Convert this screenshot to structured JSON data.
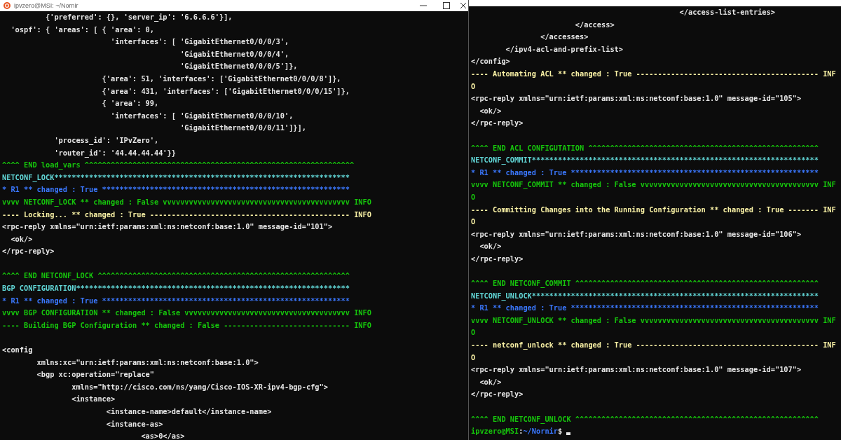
{
  "windows": [
    {
      "title": "ipvzero@MSI: ~/Nornir",
      "lines": [
        {
          "kind": "text",
          "color": "#e6e6e6",
          "text": "          {'preferred': {}, 'server_ip': '6.6.6.6'}],"
        },
        {
          "kind": "text",
          "color": "#e6e6e6",
          "text": "  'ospf': { 'areas': [ { 'area': 0,"
        },
        {
          "kind": "text",
          "color": "#e6e6e6",
          "text": "                         'interfaces': [ 'GigabitEthernet0/0/0/3',"
        },
        {
          "kind": "text",
          "color": "#e6e6e6",
          "text": "                                         'GigabitEthernet0/0/0/4',"
        },
        {
          "kind": "text",
          "color": "#e6e6e6",
          "text": "                                         'GigabitEthernet0/0/0/5']},"
        },
        {
          "kind": "text",
          "color": "#e6e6e6",
          "text": "                       {'area': 51, 'interfaces': ['GigabitEthernet0/0/0/8']},"
        },
        {
          "kind": "text",
          "color": "#e6e6e6",
          "text": "                       {'area': 431, 'interfaces': ['GigabitEthernet0/0/0/15']},"
        },
        {
          "kind": "text",
          "color": "#e6e6e6",
          "text": "                       { 'area': 99,"
        },
        {
          "kind": "text",
          "color": "#e6e6e6",
          "text": "                         'interfaces': [ 'GigabitEthernet0/0/0/10',"
        },
        {
          "kind": "text",
          "color": "#e6e6e6",
          "text": "                                         'GigabitEthernet0/0/0/11']}],"
        },
        {
          "kind": "text",
          "color": "#e6e6e6",
          "text": "            'process_id': 'IPvZero',"
        },
        {
          "kind": "text",
          "color": "#e6e6e6",
          "text": "            'router_id': '44.44.44.44'}}"
        },
        {
          "kind": "text",
          "color": "#16c60c",
          "text": "^^^^ END load_vars ^^^^^^^^^^^^^^^^^^^^^^^^^^^^^^^^^^^^^^^^^^^^^^^^^^^^^^^^^^^^^^"
        },
        {
          "kind": "text",
          "color": "#61d6d6",
          "text": "NETCONF_LOCK********************************************************************"
        },
        {
          "kind": "text",
          "color": "#3b78ff",
          "text": "* R1 ** changed : True *********************************************************"
        },
        {
          "kind": "text",
          "color": "#16c60c",
          "text": "vvvv NETCONF_LOCK ** changed : False vvvvvvvvvvvvvvvvvvvvvvvvvvvvvvvvvvvvvvvvvvv INFO"
        },
        {
          "kind": "text",
          "color": "#f9f1a5",
          "text": "---- Locking... ** changed : True ---------------------------------------------- INFO"
        },
        {
          "kind": "text",
          "color": "#e6e6e6",
          "text": "<rpc-reply xmlns=\"urn:ietf:params:xml:ns:netconf:base:1.0\" message-id=\"101\">"
        },
        {
          "kind": "text",
          "color": "#e6e6e6",
          "text": "  <ok/>"
        },
        {
          "kind": "text",
          "color": "#e6e6e6",
          "text": "</rpc-reply>"
        },
        {
          "kind": "blank"
        },
        {
          "kind": "text",
          "color": "#16c60c",
          "text": "^^^^ END NETCONF_LOCK ^^^^^^^^^^^^^^^^^^^^^^^^^^^^^^^^^^^^^^^^^^^^^^^^^^^^^^^^^^"
        },
        {
          "kind": "text",
          "color": "#61d6d6",
          "text": "BGP CONFIGURATION***************************************************************"
        },
        {
          "kind": "text",
          "color": "#3b78ff",
          "text": "* R1 ** changed : True *********************************************************"
        },
        {
          "kind": "text",
          "color": "#16c60c",
          "text": "vvvv BGP CONFIGURATION ** changed : False vvvvvvvvvvvvvvvvvvvvvvvvvvvvvvvvvvvvvv INFO"
        },
        {
          "kind": "text",
          "color": "#16c60c",
          "text": "---- Building BGP Configuration ** changed : False ----------------------------- INFO"
        },
        {
          "kind": "blank"
        },
        {
          "kind": "text",
          "color": "#e6e6e6",
          "text": "<config"
        },
        {
          "kind": "text",
          "color": "#e6e6e6",
          "text": "        xmlns:xc=\"urn:ietf:params:xml:ns:netconf:base:1.0\">"
        },
        {
          "kind": "text",
          "color": "#e6e6e6",
          "text": "        <bgp xc:operation=\"replace\""
        },
        {
          "kind": "text",
          "color": "#e6e6e6",
          "text": "                xmlns=\"http://cisco.com/ns/yang/Cisco-IOS-XR-ipv4-bgp-cfg\">"
        },
        {
          "kind": "text",
          "color": "#e6e6e6",
          "text": "                <instance>"
        },
        {
          "kind": "text",
          "color": "#e6e6e6",
          "text": "                        <instance-name>default</instance-name>"
        },
        {
          "kind": "text",
          "color": "#e6e6e6",
          "text": "                        <instance-as>"
        },
        {
          "kind": "text",
          "color": "#e6e6e6",
          "text": "                                <as>0</as>"
        }
      ]
    },
    {
      "lines": [
        {
          "kind": "text",
          "color": "#e6e6e6",
          "text": "                                                </access-list-entries>"
        },
        {
          "kind": "text",
          "color": "#e6e6e6",
          "text": "                        </access>"
        },
        {
          "kind": "text",
          "color": "#e6e6e6",
          "text": "                </accesses>"
        },
        {
          "kind": "text",
          "color": "#e6e6e6",
          "text": "        </ipv4-acl-and-prefix-list>"
        },
        {
          "kind": "text",
          "color": "#e6e6e6",
          "text": "</config>"
        },
        {
          "kind": "text",
          "color": "#f9f1a5",
          "text": "---- Automating ACL ** changed : True ------------------------------------------ INF"
        },
        {
          "kind": "text",
          "color": "#f9f1a5",
          "text": "O"
        },
        {
          "kind": "text",
          "color": "#e6e6e6",
          "text": "<rpc-reply xmlns=\"urn:ietf:params:xml:ns:netconf:base:1.0\" message-id=\"105\">"
        },
        {
          "kind": "text",
          "color": "#e6e6e6",
          "text": "  <ok/>"
        },
        {
          "kind": "text",
          "color": "#e6e6e6",
          "text": "</rpc-reply>"
        },
        {
          "kind": "blank"
        },
        {
          "kind": "text",
          "color": "#16c60c",
          "text": "^^^^ END ACL CONFIGUTATION ^^^^^^^^^^^^^^^^^^^^^^^^^^^^^^^^^^^^^^^^^^^^^^^^^^^^^"
        },
        {
          "kind": "text",
          "color": "#61d6d6",
          "text": "NETCONF_COMMIT******************************************************************"
        },
        {
          "kind": "text",
          "color": "#3b78ff",
          "text": "* R1 ** changed : True *********************************************************"
        },
        {
          "kind": "text",
          "color": "#16c60c",
          "text": "vvvv NETCONF_COMMIT ** changed : False vvvvvvvvvvvvvvvvvvvvvvvvvvvvvvvvvvvvvvvvv INF"
        },
        {
          "kind": "text",
          "color": "#16c60c",
          "text": "O"
        },
        {
          "kind": "text",
          "color": "#f9f1a5",
          "text": "---- Committing Changes into the Running Configuration ** changed : True ------- INF"
        },
        {
          "kind": "text",
          "color": "#f9f1a5",
          "text": "O"
        },
        {
          "kind": "text",
          "color": "#e6e6e6",
          "text": "<rpc-reply xmlns=\"urn:ietf:params:xml:ns:netconf:base:1.0\" message-id=\"106\">"
        },
        {
          "kind": "text",
          "color": "#e6e6e6",
          "text": "  <ok/>"
        },
        {
          "kind": "text",
          "color": "#e6e6e6",
          "text": "</rpc-reply>"
        },
        {
          "kind": "blank"
        },
        {
          "kind": "text",
          "color": "#16c60c",
          "text": "^^^^ END NETCONF_COMMIT ^^^^^^^^^^^^^^^^^^^^^^^^^^^^^^^^^^^^^^^^^^^^^^^^^^^^^^^^"
        },
        {
          "kind": "text",
          "color": "#61d6d6",
          "text": "NETCONF_UNLOCK******************************************************************"
        },
        {
          "kind": "text",
          "color": "#3b78ff",
          "text": "* R1 ** changed : True *********************************************************"
        },
        {
          "kind": "text",
          "color": "#16c60c",
          "text": "vvvv NETCONF_UNLOCK ** changed : False vvvvvvvvvvvvvvvvvvvvvvvvvvvvvvvvvvvvvvvvv INF"
        },
        {
          "kind": "text",
          "color": "#16c60c",
          "text": "O"
        },
        {
          "kind": "text",
          "color": "#f9f1a5",
          "text": "---- netconf_unlock ** changed : True ------------------------------------------ INF"
        },
        {
          "kind": "text",
          "color": "#f9f1a5",
          "text": "O"
        },
        {
          "kind": "text",
          "color": "#e6e6e6",
          "text": "<rpc-reply xmlns=\"urn:ietf:params:xml:ns:netconf:base:1.0\" message-id=\"107\">"
        },
        {
          "kind": "text",
          "color": "#e6e6e6",
          "text": "  <ok/>"
        },
        {
          "kind": "text",
          "color": "#e6e6e6",
          "text": "</rpc-reply>"
        },
        {
          "kind": "blank"
        },
        {
          "kind": "text",
          "color": "#16c60c",
          "text": "^^^^ END NETCONF_UNLOCK ^^^^^^^^^^^^^^^^^^^^^^^^^^^^^^^^^^^^^^^^^^^^^^^^^^^^^^^^"
        },
        {
          "kind": "prompt",
          "segments": [
            {
              "text": "ipvzero@MSI",
              "color": "#16c60c"
            },
            {
              "text": ":",
              "color": "#e6e6e6"
            },
            {
              "text": "~/Nornir",
              "color": "#3b78ff"
            },
            {
              "text": "$",
              "color": "#e6e6e6"
            }
          ]
        }
      ]
    }
  ]
}
